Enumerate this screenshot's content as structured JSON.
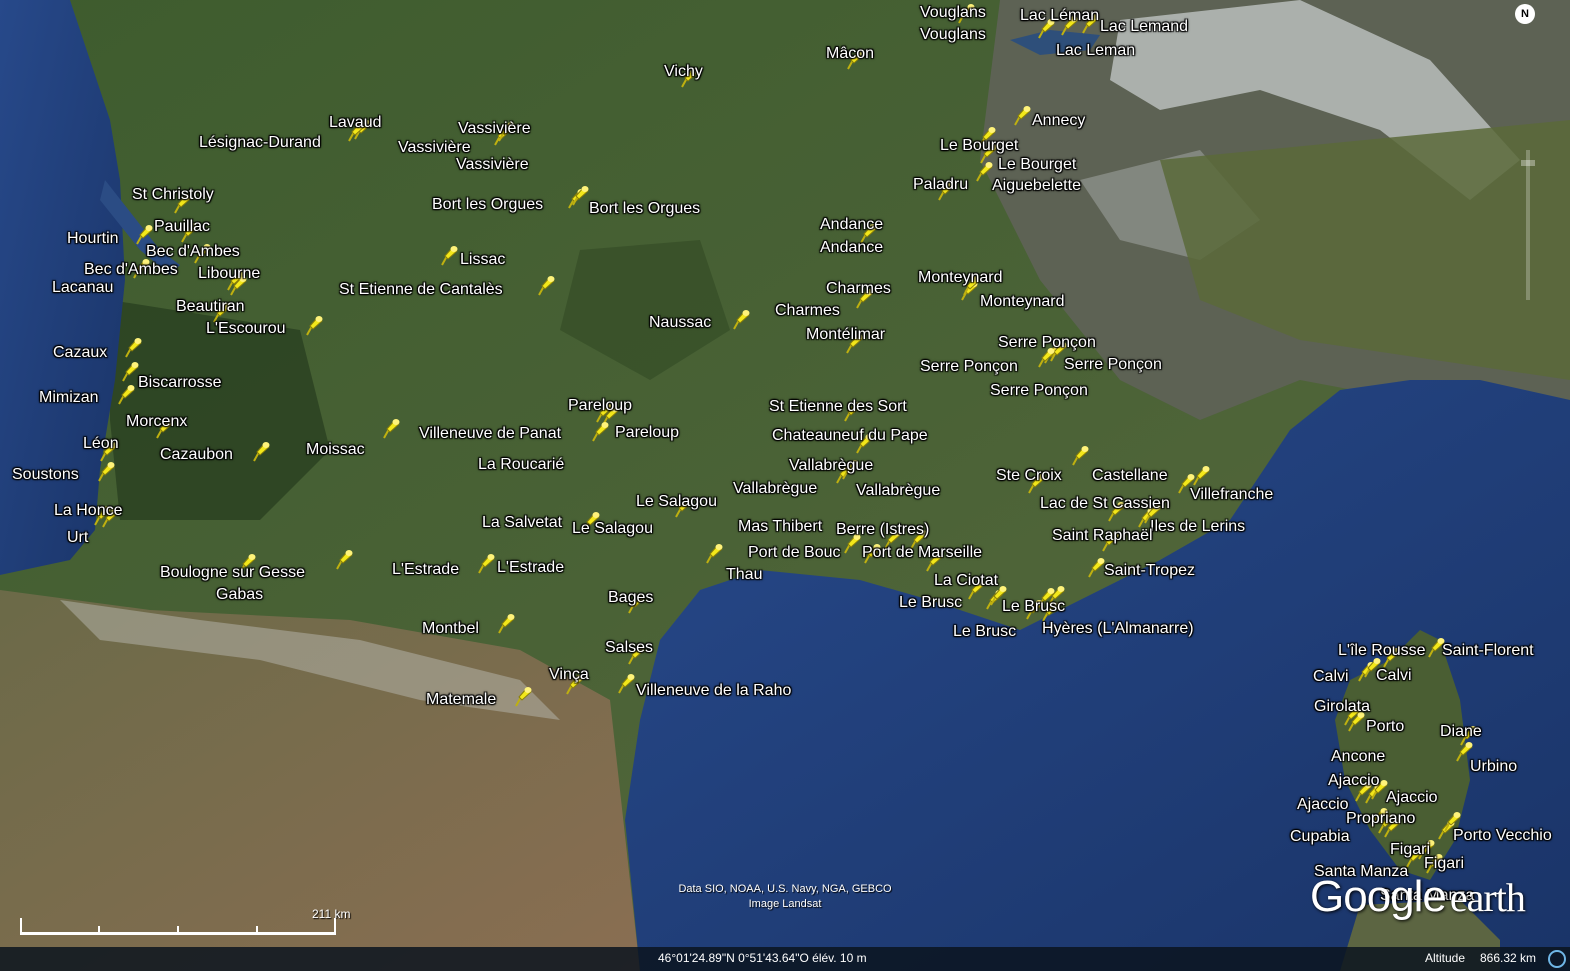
{
  "app": {
    "title": "Google earth",
    "logo_google": "Google",
    "logo_earth": "earth",
    "compass_letter": "N"
  },
  "colors": {
    "land": "#3c5a2c",
    "sea": "#1e3d78",
    "mountain_snow": "#dfe5e8",
    "pin": "#f3e81a",
    "label": "#ffffff"
  },
  "imagery_credits": [
    "Data SIO, NOAA, U.S. Navy, NGA, GEBCO",
    "Image Landsat"
  ],
  "scale": {
    "label": "211 km"
  },
  "status": {
    "coordinates": "46°01'24.89\"N    0°51'43.64\"O  élév.    10 m",
    "altitude_label": "Altitude",
    "altitude_value": "866.32 km"
  },
  "labels": [
    "Vouglans",
    "Vouglans",
    "Lac Léman",
    "Lac Lemand",
    "Lac Leman",
    "Mâcon",
    "Vichy",
    "Annecy",
    "Lavaud",
    "Lésignac-Durand",
    "Vassivière",
    "Vassivière",
    "Vassivière",
    "Le Bourget",
    "Le Bourget",
    "Paladru",
    "Aiguebelette",
    "St Christoly",
    "Bort les Orgues",
    "Bort les Orgues",
    "Pauillac",
    "Hourtin",
    "Bec d'Ambes",
    "Andance",
    "Andance",
    "Bec d'Ambes",
    "Libourne",
    "Lissac",
    "Lacanau",
    "St Etienne de Cantalès",
    "Monteynard",
    "Charmes",
    "Monteynard",
    "Beautiran",
    "Charmes",
    "L'Escourou",
    "Naussac",
    "Montélimar",
    "Serre Ponçon",
    "Cazaux",
    "Serre Ponçon",
    "Serre Ponçon",
    "Biscarrosse",
    "Serre Ponçon",
    "Mimizan",
    "St Etienne des Sort",
    "Pareloup",
    "Morcenx",
    "Villeneuve de Panat",
    "Pareloup",
    "Chateauneuf du Pape",
    "Léon",
    "Moissac",
    "Cazaubon",
    "Vallabrègue",
    "La Roucarié",
    "Soustons",
    "Ste Croix",
    "Castellane",
    "Vallabrègue",
    "Vallabrègue",
    "Villefranche",
    "Le Salagou",
    "Lac de St Cassien",
    "La Honce",
    "La Salvetat",
    "Mas Thibert",
    "Le Salagou",
    "Berre (Istres)",
    "Iles de Lerins",
    "Urt",
    "Saint Raphaël",
    "Port de Bouc",
    "Port de Marseille",
    "Boulogne sur Gesse",
    "L'Estrade",
    "L'Estrade",
    "Thau",
    "Saint-Tropez",
    "La Ciotat",
    "Gabas",
    "Bages",
    "Le Brusc",
    "Le Brusc",
    "Montbel",
    "Le Brusc",
    "Hyères (L'Almanarre)",
    "Salses",
    "L'île Rousse",
    "Saint-Florent",
    "Calvi",
    "Calvi",
    "Vinça",
    "Villeneuve de la Raho",
    "Matemale",
    "Girolata",
    "Porto",
    "Diane",
    "Ancone",
    "Urbino",
    "Ajaccio",
    "Ajaccio",
    "Ajaccio",
    "Propriano",
    "Cupabia",
    "Porto Vecchio",
    "Figari",
    "Figari",
    "Santa Manza",
    "Santa Manza"
  ],
  "pin_count": 120
}
